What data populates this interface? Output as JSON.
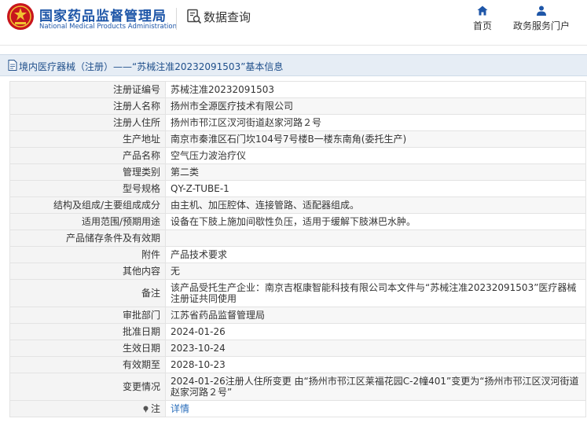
{
  "header": {
    "org_cn": "国家药品监督管理局",
    "org_en": "National Medical Products Administration",
    "section": "数据查询",
    "nav": [
      {
        "label": "首页",
        "icon": "home-icon"
      },
      {
        "label": "政务服务门户",
        "icon": "user-icon"
      }
    ]
  },
  "title": "境内医疗器械（注册）——“苏械注准20232091503”基本信息",
  "colors": {
    "brand": "#1e56a8",
    "title_bg": "#e6edf5",
    "link": "#2a6ebb",
    "logo_red": "#c8161d",
    "logo_gold": "#f1c232"
  },
  "rows": [
    {
      "label": "注册证编号",
      "value": "苏械注准20232091503"
    },
    {
      "label": "注册人名称",
      "value": "扬州市全源医疗技术有限公司"
    },
    {
      "label": "注册人住所",
      "value": "扬州市邗江区汊河街道赵家河路２号"
    },
    {
      "label": "生产地址",
      "value": "南京市秦淮区石门坎104号7号楼B一楼东南角(委托生产)"
    },
    {
      "label": "产品名称",
      "value": "空气压力波治疗仪"
    },
    {
      "label": "管理类别",
      "value": "第二类"
    },
    {
      "label": "型号规格",
      "value": "QY-Z-TUBE-1"
    },
    {
      "label": "结构及组成/主要组成成分",
      "value": "由主机、加压腔体、连接管路、适配器组成。"
    },
    {
      "label": "适用范围/预期用途",
      "value": "设备在下肢上施加间歇性负压，适用于缓解下肢淋巴水肿。"
    },
    {
      "label": "产品储存条件及有效期",
      "value": ""
    },
    {
      "label": "附件",
      "value": "产品技术要求"
    },
    {
      "label": "其他内容",
      "value": "无"
    },
    {
      "label": "备注",
      "value": "该产品受托生产企业：南京吉枢康智能科技有限公司本文件与“苏械注准20232091503”医疗器械注册证共同使用"
    },
    {
      "label": "审批部门",
      "value": "江苏省药品监督管理局"
    },
    {
      "label": "批准日期",
      "value": "2024-01-26"
    },
    {
      "label": "生效日期",
      "value": "2023-10-24"
    },
    {
      "label": "有效期至",
      "value": "2028-10-23"
    },
    {
      "label": "变更情况",
      "value": "2024-01-26注册人住所变更 由“扬州市邗江区莱福花园C-2幢401”变更为“扬州市邗江区汊河街道赵家河路２号”"
    }
  ],
  "note_row": {
    "label": "注",
    "link": "详情"
  }
}
